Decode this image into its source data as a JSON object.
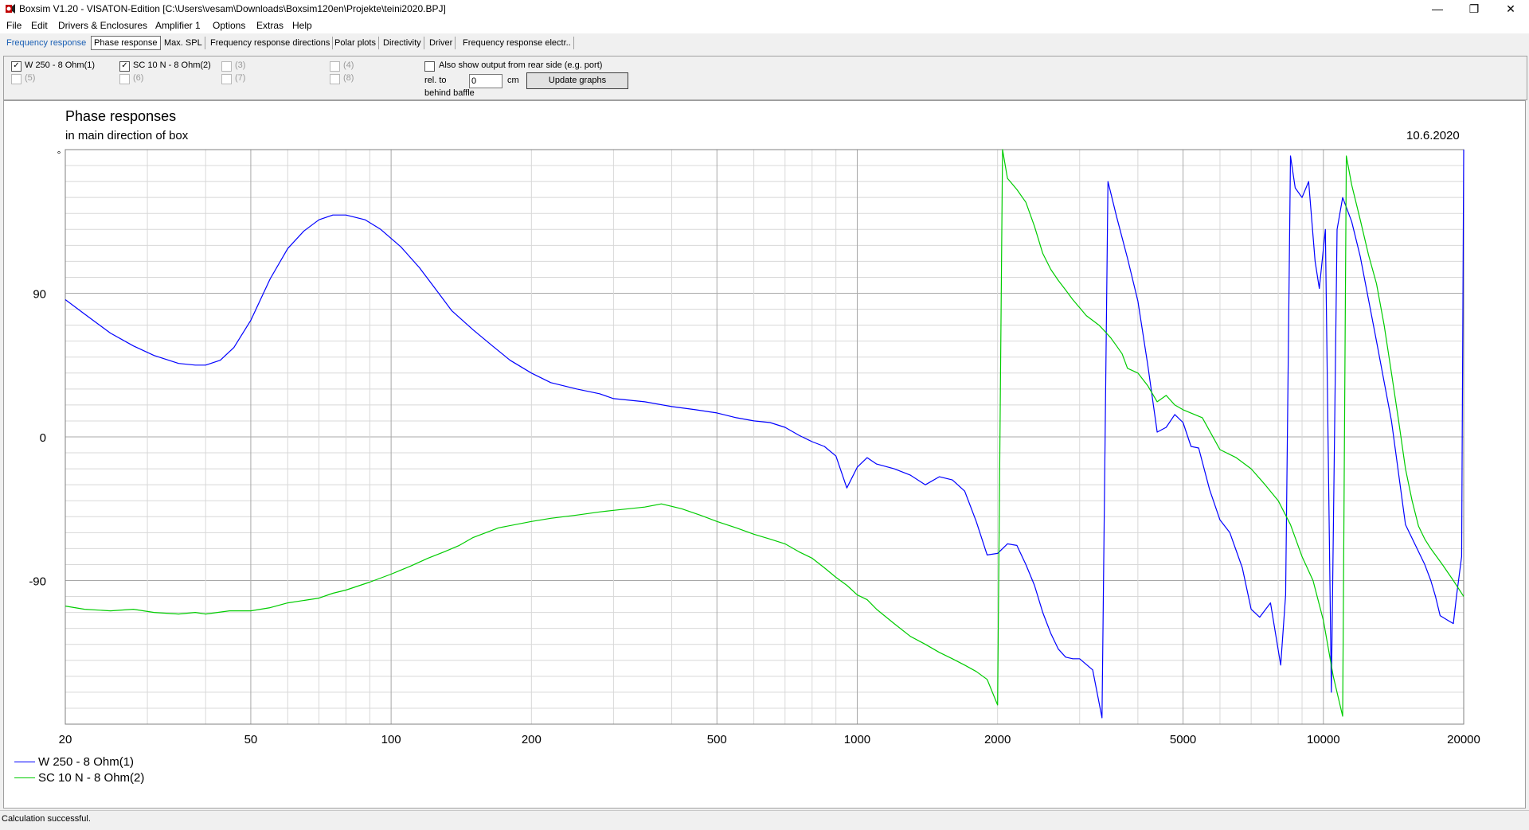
{
  "window": {
    "title": "Boxsim V1.20 - VISATON-Edition [C:\\Users\\vesam\\Downloads\\Boxsim120en\\Projekte\\teini2020.BPJ]",
    "minimize": "—",
    "maximize": "❐",
    "close": "✕"
  },
  "menu": [
    "File",
    "Edit",
    "Drivers & Enclosures",
    "Amplifier 1",
    "Options",
    "Extras",
    "Help"
  ],
  "tabs": [
    "Frequency response",
    "Phase response",
    "Max. SPL",
    "Frequency response directions",
    "Polar plots",
    "Directivity",
    "Driver",
    "Frequency response electr.."
  ],
  "selected_tab": "Phase response",
  "options": {
    "drivers": [
      {
        "label": "W 250 - 8 Ohm(1)",
        "checked": true,
        "enabled": true
      },
      {
        "label": "SC 10 N - 8 Ohm(2)",
        "checked": true,
        "enabled": true
      },
      {
        "label": "(3)",
        "checked": false,
        "enabled": false
      },
      {
        "label": "(4)",
        "checked": false,
        "enabled": false
      },
      {
        "label": "(5)",
        "checked": false,
        "enabled": false
      },
      {
        "label": "(6)",
        "checked": false,
        "enabled": false
      },
      {
        "label": "(7)",
        "checked": false,
        "enabled": false
      },
      {
        "label": "(8)",
        "checked": false,
        "enabled": false
      }
    ],
    "rear_side_label": "Also show output from rear side (e.g. port)",
    "rel_to_label": "rel. to",
    "behind_baffle_label": "behind baffle",
    "cm_value": "0",
    "cm_label": "cm",
    "update_button": "Update graphs"
  },
  "status": "Calculation successful.",
  "chart_data": {
    "type": "line",
    "title": "Phase responses",
    "subtitle": "in main direction of box",
    "date": "10.6.2020",
    "ylabel": "°",
    "xscale": "log",
    "xlim": [
      20,
      20000
    ],
    "ylim": [
      -180,
      180
    ],
    "xticks": [
      20,
      50,
      100,
      200,
      500,
      1000,
      2000,
      5000,
      10000,
      20000
    ],
    "yticks": [
      90,
      0,
      -90
    ],
    "grid": true,
    "legend_position": "bottom-left",
    "series": [
      {
        "name": "W 250 - 8 Ohm(1)",
        "color": "#0000ff",
        "points": [
          [
            20,
            86
          ],
          [
            22,
            77
          ],
          [
            25,
            65
          ],
          [
            28,
            57
          ],
          [
            31,
            51
          ],
          [
            35,
            46
          ],
          [
            38,
            45
          ],
          [
            40,
            45
          ],
          [
            43,
            48
          ],
          [
            46,
            56
          ],
          [
            50,
            73
          ],
          [
            55,
            99
          ],
          [
            60,
            118
          ],
          [
            65,
            129
          ],
          [
            70,
            136
          ],
          [
            75,
            139
          ],
          [
            80,
            139
          ],
          [
            88,
            136
          ],
          [
            95,
            130
          ],
          [
            105,
            119
          ],
          [
            115,
            106
          ],
          [
            125,
            92
          ],
          [
            135,
            79
          ],
          [
            150,
            67
          ],
          [
            165,
            57
          ],
          [
            180,
            48
          ],
          [
            200,
            40
          ],
          [
            220,
            34
          ],
          [
            250,
            30
          ],
          [
            280,
            27
          ],
          [
            300,
            24
          ],
          [
            350,
            22
          ],
          [
            400,
            19
          ],
          [
            450,
            17
          ],
          [
            500,
            15
          ],
          [
            550,
            12
          ],
          [
            600,
            10
          ],
          [
            650,
            9
          ],
          [
            700,
            6
          ],
          [
            750,
            1
          ],
          [
            800,
            -3
          ],
          [
            850,
            -6
          ],
          [
            900,
            -12
          ],
          [
            950,
            -32
          ],
          [
            1000,
            -19
          ],
          [
            1050,
            -13
          ],
          [
            1100,
            -17
          ],
          [
            1200,
            -20
          ],
          [
            1300,
            -24
          ],
          [
            1400,
            -30
          ],
          [
            1500,
            -25
          ],
          [
            1600,
            -27
          ],
          [
            1700,
            -34
          ],
          [
            1800,
            -53
          ],
          [
            1900,
            -74
          ],
          [
            2000,
            -73
          ],
          [
            2100,
            -67
          ],
          [
            2200,
            -68
          ],
          [
            2300,
            -80
          ],
          [
            2400,
            -93
          ],
          [
            2500,
            -110
          ],
          [
            2600,
            -123
          ],
          [
            2700,
            -133
          ],
          [
            2800,
            -138
          ],
          [
            2900,
            -139
          ],
          [
            3000,
            -139
          ],
          [
            3200,
            -146
          ],
          [
            3350,
            -176
          ],
          [
            3450,
            160
          ],
          [
            3600,
            138
          ],
          [
            3800,
            112
          ],
          [
            4000,
            85
          ],
          [
            4200,
            45
          ],
          [
            4400,
            3
          ],
          [
            4600,
            6
          ],
          [
            4800,
            14
          ],
          [
            5000,
            9
          ],
          [
            5200,
            -6
          ],
          [
            5400,
            -7
          ],
          [
            5700,
            -33
          ],
          [
            6000,
            -52
          ],
          [
            6300,
            -60
          ],
          [
            6700,
            -82
          ],
          [
            7000,
            -108
          ],
          [
            7300,
            -113
          ],
          [
            7700,
            -104
          ],
          [
            8100,
            -143
          ],
          [
            8300,
            -99
          ],
          [
            8500,
            176
          ],
          [
            8700,
            156
          ],
          [
            9000,
            150
          ],
          [
            9300,
            160
          ],
          [
            9600,
            110
          ],
          [
            9800,
            93
          ],
          [
            10100,
            130
          ],
          [
            10400,
            -160
          ],
          [
            10700,
            130
          ],
          [
            11000,
            150
          ],
          [
            11500,
            135
          ],
          [
            12000,
            113
          ],
          [
            13000,
            60
          ],
          [
            14000,
            10
          ],
          [
            15000,
            -55
          ],
          [
            16500,
            -80
          ],
          [
            17000,
            -90
          ],
          [
            17400,
            -100
          ],
          [
            17800,
            -112
          ],
          [
            18500,
            -115
          ],
          [
            19000,
            -117
          ],
          [
            19300,
            -100
          ],
          [
            19800,
            -75
          ],
          [
            20000,
            180
          ]
        ]
      },
      {
        "name": "SC 10 N - 8 Ohm(2)",
        "color": "#00cc00",
        "points": [
          [
            20,
            -106
          ],
          [
            22,
            -108
          ],
          [
            25,
            -109
          ],
          [
            28,
            -108
          ],
          [
            31,
            -110
          ],
          [
            35,
            -111
          ],
          [
            38,
            -110
          ],
          [
            40,
            -111
          ],
          [
            45,
            -109
          ],
          [
            50,
            -109
          ],
          [
            55,
            -107
          ],
          [
            60,
            -104
          ],
          [
            70,
            -101
          ],
          [
            75,
            -98
          ],
          [
            80,
            -96
          ],
          [
            90,
            -91
          ],
          [
            100,
            -86
          ],
          [
            110,
            -81
          ],
          [
            120,
            -76
          ],
          [
            130,
            -72
          ],
          [
            140,
            -68
          ],
          [
            150,
            -63
          ],
          [
            170,
            -57
          ],
          [
            200,
            -53
          ],
          [
            220,
            -51
          ],
          [
            250,
            -49
          ],
          [
            280,
            -47
          ],
          [
            300,
            -46
          ],
          [
            350,
            -44
          ],
          [
            380,
            -42
          ],
          [
            420,
            -45
          ],
          [
            460,
            -49
          ],
          [
            500,
            -53
          ],
          [
            550,
            -57
          ],
          [
            600,
            -61
          ],
          [
            650,
            -64
          ],
          [
            700,
            -67
          ],
          [
            750,
            -72
          ],
          [
            800,
            -76
          ],
          [
            850,
            -82
          ],
          [
            900,
            -88
          ],
          [
            950,
            -93
          ],
          [
            1000,
            -99
          ],
          [
            1050,
            -102
          ],
          [
            1100,
            -108
          ],
          [
            1200,
            -117
          ],
          [
            1300,
            -125
          ],
          [
            1400,
            -130
          ],
          [
            1500,
            -135
          ],
          [
            1600,
            -139
          ],
          [
            1700,
            -143
          ],
          [
            1800,
            -147
          ],
          [
            1900,
            -152
          ],
          [
            2000,
            -168
          ],
          [
            2050,
            180
          ],
          [
            2100,
            162
          ],
          [
            2200,
            155
          ],
          [
            2300,
            147
          ],
          [
            2400,
            132
          ],
          [
            2500,
            115
          ],
          [
            2600,
            105
          ],
          [
            2700,
            98
          ],
          [
            2800,
            92
          ],
          [
            2900,
            86
          ],
          [
            3000,
            81
          ],
          [
            3100,
            76
          ],
          [
            3200,
            73
          ],
          [
            3300,
            70
          ],
          [
            3400,
            66
          ],
          [
            3500,
            62
          ],
          [
            3600,
            57
          ],
          [
            3700,
            52
          ],
          [
            3800,
            43
          ],
          [
            4000,
            40
          ],
          [
            4200,
            32
          ],
          [
            4400,
            22
          ],
          [
            4600,
            26
          ],
          [
            4800,
            20
          ],
          [
            5000,
            17
          ],
          [
            5500,
            12
          ],
          [
            6000,
            -8
          ],
          [
            6500,
            -13
          ],
          [
            7000,
            -20
          ],
          [
            7500,
            -30
          ],
          [
            8000,
            -40
          ],
          [
            8500,
            -55
          ],
          [
            9000,
            -75
          ],
          [
            9500,
            -90
          ],
          [
            10000,
            -115
          ],
          [
            10500,
            -150
          ],
          [
            11000,
            -175
          ],
          [
            11200,
            176
          ],
          [
            11500,
            158
          ],
          [
            12000,
            136
          ],
          [
            12500,
            114
          ],
          [
            13000,
            96
          ],
          [
            13500,
            70
          ],
          [
            14000,
            40
          ],
          [
            14500,
            10
          ],
          [
            15000,
            -20
          ],
          [
            15500,
            -40
          ],
          [
            16000,
            -56
          ],
          [
            16500,
            -64
          ],
          [
            17000,
            -70
          ],
          [
            18000,
            -80
          ],
          [
            19000,
            -90
          ],
          [
            20000,
            -100
          ]
        ]
      }
    ]
  }
}
